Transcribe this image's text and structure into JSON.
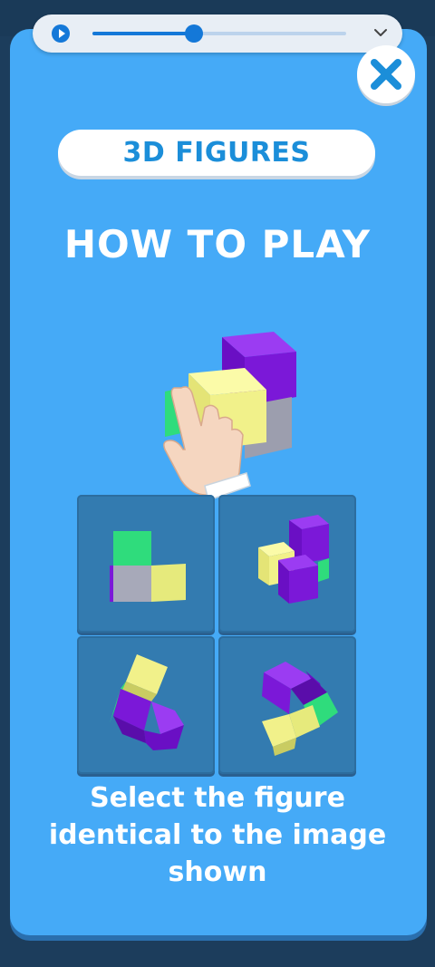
{
  "media_bar": {
    "progress": 0.4
  },
  "title": "3D FIGURES",
  "heading": "HOW TO PLAY",
  "instructions": "Select the figure identical to the image shown",
  "colors": {
    "panel": "#45aaf7",
    "title_text": "#1b8ed9",
    "cell": "#337bb0",
    "purple": "#7b18d8",
    "yellow": "#f1f18a",
    "green": "#2fdc7c",
    "gray": "#a7a9b9"
  },
  "icons": [
    "play-icon",
    "chevron-down-icon",
    "close-icon",
    "hand-pointer-icon"
  ],
  "options": [
    {
      "name": "option-1"
    },
    {
      "name": "option-2"
    },
    {
      "name": "option-3"
    },
    {
      "name": "option-4"
    }
  ]
}
